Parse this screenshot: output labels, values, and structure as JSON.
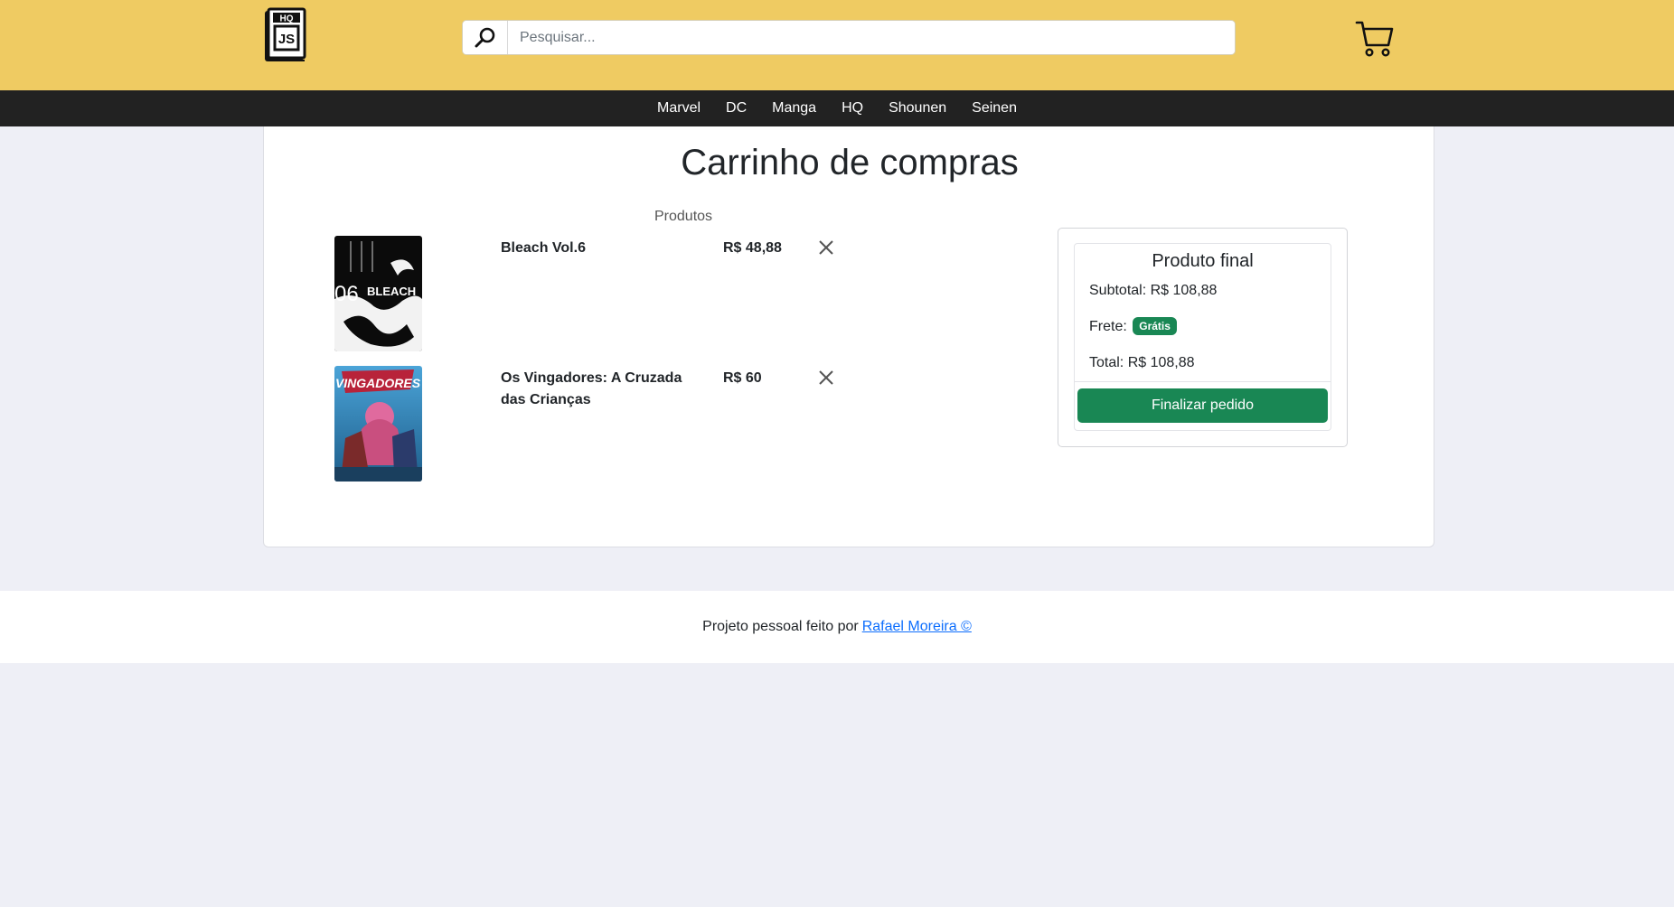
{
  "header": {
    "logo": {
      "top_text": "HQ",
      "main_text": "JS"
    },
    "search": {
      "placeholder": "Pesquisar...",
      "value": "",
      "icon": "search-icon"
    },
    "cart_icon": "cart-icon"
  },
  "nav": {
    "items": [
      {
        "label": "Marvel"
      },
      {
        "label": "DC"
      },
      {
        "label": "Manga"
      },
      {
        "label": "HQ"
      },
      {
        "label": "Shounen"
      },
      {
        "label": "Seinen"
      }
    ]
  },
  "cart": {
    "title": "Carrinho de compras",
    "products_label": "Produtos",
    "items": [
      {
        "name": "Bleach Vol.6",
        "price": "R$ 48,88",
        "cover_text": "06 BLEACH",
        "remove_icon": "close-icon"
      },
      {
        "name": "Os Vingadores: A Cruzada das Crianças",
        "price": "R$ 60",
        "cover_text": "VINGADORES",
        "remove_icon": "close-icon"
      }
    ]
  },
  "summary": {
    "title": "Produto final",
    "subtotal": "Subtotal: R$ 108,88",
    "shipping_label": "Frete:",
    "shipping_badge": "Grátis",
    "total": "Total: R$ 108,88",
    "button": "Finalizar pedido"
  },
  "footer": {
    "text": "Projeto pessoal feito por",
    "link": "Rafael Moreira ©"
  },
  "colors": {
    "header_bg": "#efcb62",
    "nav_bg": "#222222",
    "accent_green": "#198754",
    "link_blue": "#0d6efd",
    "page_bg": "#eeeff6"
  }
}
